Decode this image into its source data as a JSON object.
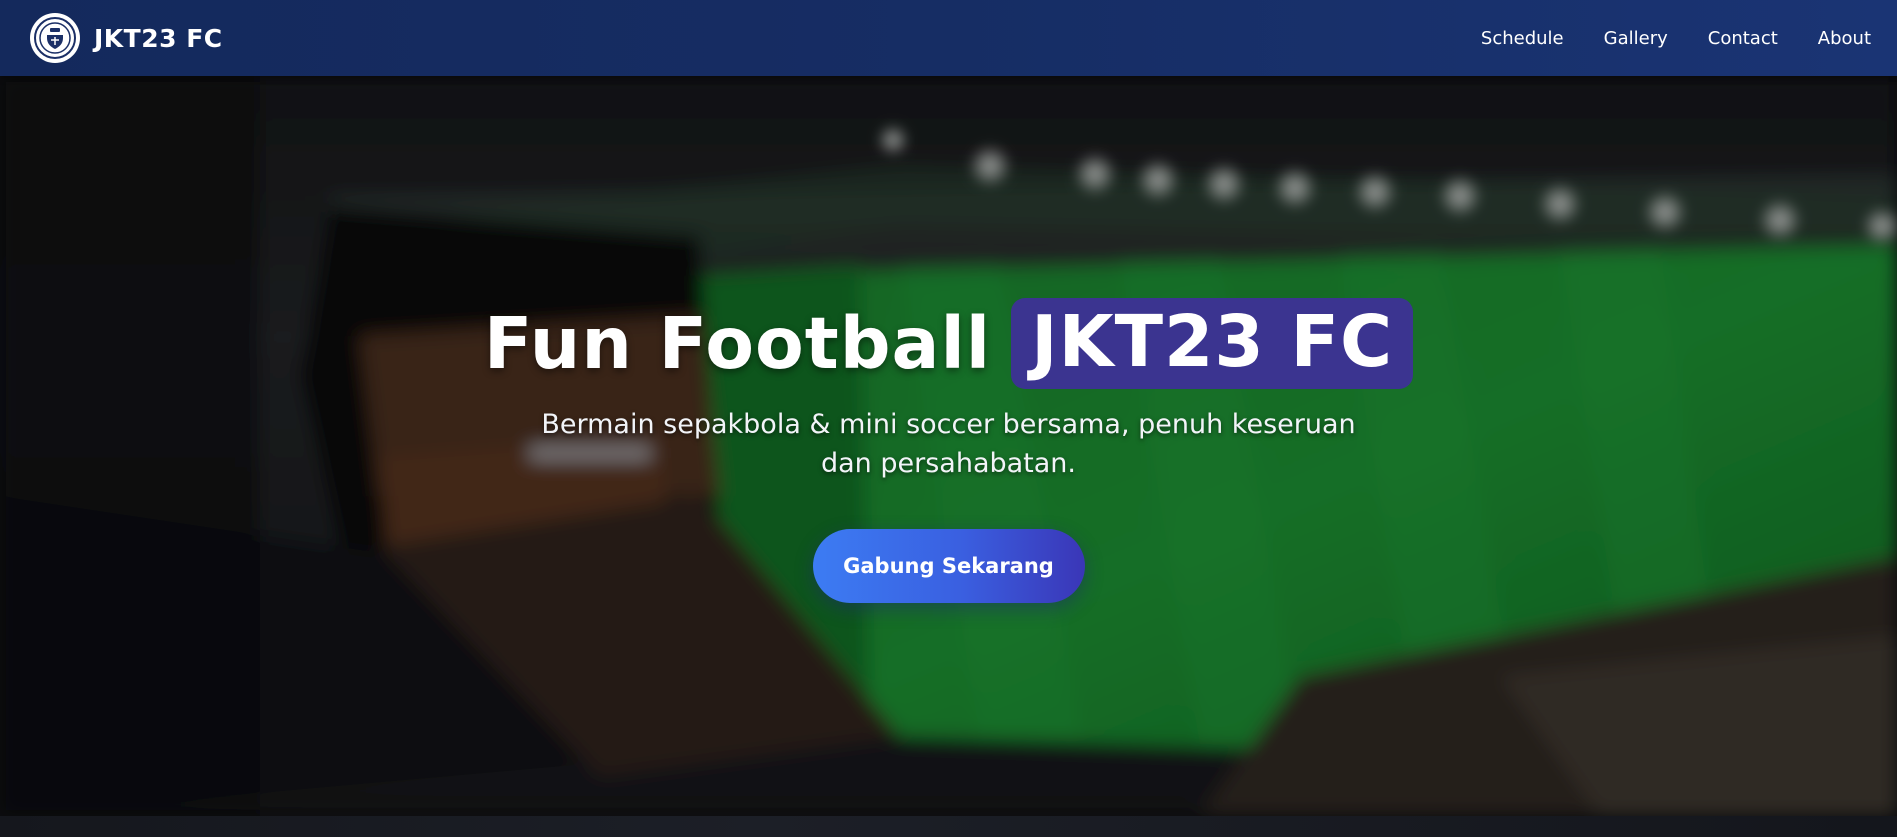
{
  "navbar": {
    "brand_name": "JKT23 FC",
    "logo_icon": "club-crest-icon",
    "links": [
      {
        "label": "Schedule"
      },
      {
        "label": "Gallery"
      },
      {
        "label": "Contact"
      },
      {
        "label": "About"
      }
    ]
  },
  "hero": {
    "title_prefix": "Fun Football",
    "title_highlight": "JKT23 FC",
    "subtitle": "Bermain sepakbola & mini soccer bersama, penuh keseruan dan persahabatan.",
    "cta_label": "Gabung Sekarang"
  },
  "colors": {
    "navbar_start": "#14295c",
    "navbar_end": "#1a3474",
    "highlight_bg": "#3b3490",
    "cta_start": "#3c7cf3",
    "cta_end": "#3a36b7",
    "pitch_green": "#1e8a2c"
  }
}
